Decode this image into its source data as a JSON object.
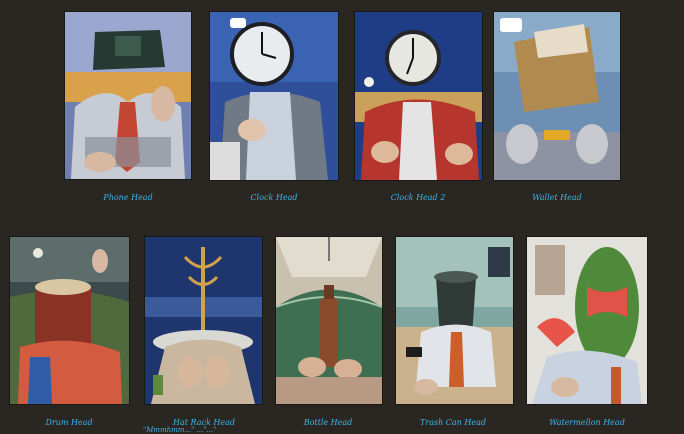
{
  "gallery": {
    "row1": [
      {
        "caption": "Phone Head"
      },
      {
        "caption": "Clock Head"
      },
      {
        "caption": "Clock Head 2"
      },
      {
        "caption": "Wallet Head"
      }
    ],
    "row2": [
      {
        "caption": "Drum Head"
      },
      {
        "caption": "Hat Rack Head"
      },
      {
        "caption": "Bottle Head"
      },
      {
        "caption": "Trash Can Head"
      },
      {
        "caption": "Watermellon Head"
      }
    ],
    "partial_caption": "\"Mmmhmm...\" ...\"...\""
  },
  "colors": {
    "background": "#2a2723",
    "caption": "#3fb4e6"
  }
}
